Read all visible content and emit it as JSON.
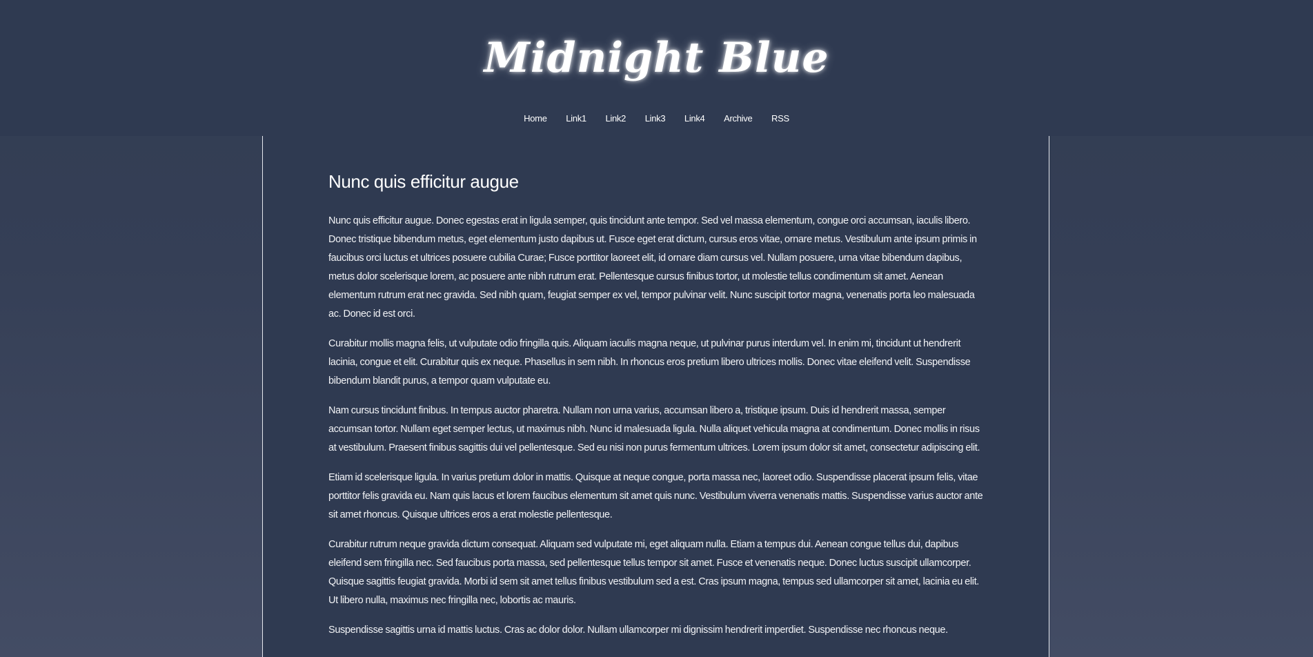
{
  "site": {
    "title": "Midnight Blue"
  },
  "nav": {
    "items": [
      {
        "label": "Home"
      },
      {
        "label": "Link1"
      },
      {
        "label": "Link2"
      },
      {
        "label": "Link3"
      },
      {
        "label": "Link4"
      },
      {
        "label": "Archive"
      },
      {
        "label": "RSS"
      }
    ]
  },
  "article": {
    "title": "Nunc quis efficitur augue",
    "paragraphs": [
      "Nunc quis efficitur augue. Donec egestas erat in ligula semper, quis tincidunt ante tempor. Sed vel massa elementum, congue orci accumsan, iaculis libero. Donec tristique bibendum metus, eget elementum justo dapibus ut. Fusce eget erat dictum, cursus eros vitae, ornare metus. Vestibulum ante ipsum primis in faucibus orci luctus et ultrices posuere cubilia Curae; Fusce porttitor laoreet elit, id ornare diam cursus vel. Nullam posuere, urna vitae bibendum dapibus, metus dolor scelerisque lorem, ac posuere ante nibh rutrum erat. Pellentesque cursus finibus tortor, ut molestie tellus condimentum sit amet. Aenean elementum rutrum erat nec gravida. Sed nibh quam, feugiat semper ex vel, tempor pulvinar velit. Nunc suscipit tortor magna, venenatis porta leo malesuada ac. Donec id est orci.",
      "Curabitur mollis magna felis, ut vulputate odio fringilla quis. Aliquam iaculis magna neque, ut pulvinar purus interdum vel. In enim mi, tincidunt ut hendrerit lacinia, congue et elit. Curabitur quis ex neque. Phasellus in sem nibh. In rhoncus eros pretium libero ultrices mollis. Donec vitae eleifend velit. Suspendisse bibendum blandit purus, a tempor quam vulputate eu.",
      "Nam cursus tincidunt finibus. In tempus auctor pharetra. Nullam non urna varius, accumsan libero a, tristique ipsum. Duis id hendrerit massa, semper accumsan tortor. Nullam eget semper lectus, ut maximus nibh. Nunc id malesuada ligula. Nulla aliquet vehicula magna at condimentum. Donec mollis in risus at vestibulum. Praesent finibus sagittis dui vel pellentesque. Sed eu nisi non purus fermentum ultrices. Lorem ipsum dolor sit amet, consectetur adipiscing elit.",
      "Etiam id scelerisque ligula. In varius pretium dolor in mattis. Quisque at neque congue, porta massa nec, laoreet odio. Suspendisse placerat ipsum felis, vitae porttitor felis gravida eu. Nam quis lacus et lorem faucibus elementum sit amet quis nunc. Vestibulum viverra venenatis mattis. Suspendisse varius auctor ante sit amet rhoncus. Quisque ultrices eros a erat molestie pellentesque.",
      "Curabitur rutrum neque gravida dictum consequat. Aliquam sed vulputate mi, eget aliquam nulla. Etiam a tempus dui. Aenean congue tellus dui, dapibus eleifend sem fringilla nec. Sed faucibus porta massa, sed pellentesque tellus tempor sit amet. Fusce et venenatis neque. Donec luctus suscipit ullamcorper. Quisque sagittis feugiat gravida. Morbi id sem sit amet tellus finibus vestibulum sed a est. Cras ipsum magna, tempus sed ullamcorper sit amet, lacinia eu elit. Ut libero nulla, maximus nec fringilla nec, lobortis ac mauris.",
      "Suspendisse sagittis urna id mattis luctus. Cras ac dolor dolor. Nullam ullamcorper mi dignissim hendrerit imperdiet. Suspendisse nec rhoncus neque."
    ]
  },
  "colors": {
    "header_bg": "#2f3a51",
    "page_bg_top": "#313c52",
    "page_bg_bottom": "#434c64",
    "content_border": "#e6e8ee",
    "text": "#f2f3f6"
  }
}
